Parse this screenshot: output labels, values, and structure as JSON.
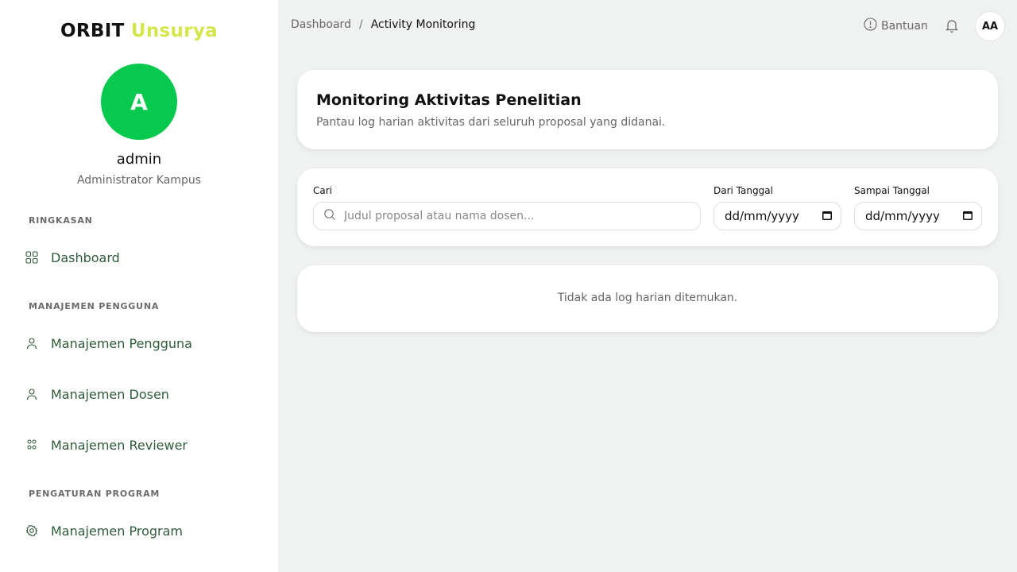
{
  "brand": {
    "part1": "ORBIT",
    "part2": "Unsurya"
  },
  "user": {
    "initial": "A",
    "name": "admin",
    "role": "Administrator Kampus"
  },
  "sidebar": {
    "sections": [
      {
        "label": "RINGKASAN"
      },
      {
        "label": "MANAJEMEN PENGGUNA"
      },
      {
        "label": "PENGATURAN PROGRAM"
      }
    ],
    "items": [
      {
        "label": "Dashboard",
        "icon": "grid-icon"
      },
      {
        "label": "Manajemen Pengguna",
        "icon": "user-icon"
      },
      {
        "label": "Manajemen Dosen",
        "icon": "user-icon"
      },
      {
        "label": "Manajemen Reviewer",
        "icon": "users-group-icon"
      },
      {
        "label": "Manajemen Program",
        "icon": "gear-icon"
      }
    ]
  },
  "breadcrumb": {
    "parent": "Dashboard",
    "separator": "/",
    "current": "Activity Monitoring"
  },
  "header": {
    "help_label": "Bantuan",
    "avatar_initials": "AA"
  },
  "page": {
    "title": "Monitoring Aktivitas Penelitian",
    "subtitle": "Pantau log harian aktivitas dari seluruh proposal yang didanai."
  },
  "filters": {
    "search_label": "Cari",
    "search_placeholder": "Judul proposal atau nama dosen...",
    "search_value": "",
    "from_label": "Dari Tanggal",
    "from_value": "dd/mm/yyyy",
    "to_label": "Sampai Tanggal",
    "to_value": "dd/mm/yyyy"
  },
  "empty_state": {
    "message": "Tidak ada log harian ditemukan."
  },
  "colors": {
    "brand_accent": "#d4e64b",
    "avatar_bg": "#06c94d",
    "nav_text": "#2f5a3a",
    "page_bg": "#eff2f0"
  }
}
